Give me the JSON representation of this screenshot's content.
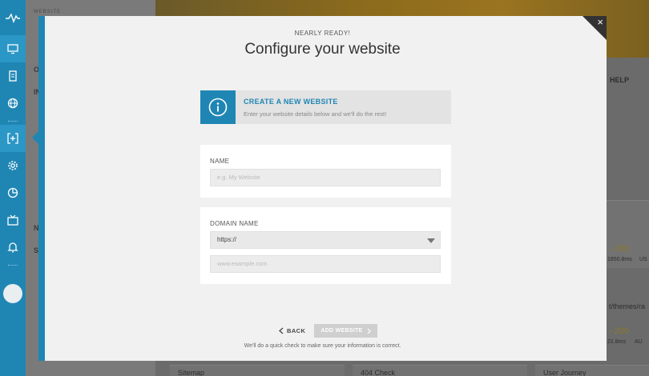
{
  "background": {
    "sidebar_labels": [
      "O",
      "IN",
      "N",
      "S"
    ],
    "sidebar_tiny": "WEBSITE",
    "help_label": "HELP",
    "cards": [
      {
        "status": "- 200",
        "timing": "1850.8ms",
        "region": "US"
      },
      {
        "status": "- 200",
        "timing": "21.8ms",
        "region": "AU"
      }
    ],
    "path_text": "t/themes/ra",
    "bottom_tabs": [
      "Sitemap",
      "404 Check",
      "User Journey"
    ]
  },
  "rail": {
    "icons": [
      "pulse-logo-icon",
      "monitor-icon",
      "server-icon",
      "globe-icon",
      "add-bracket-icon",
      "gear-icon",
      "pie-chart-icon",
      "tv-icon",
      "bell-icon"
    ]
  },
  "modal": {
    "eyebrow": "NEARLY READY!",
    "title": "Configure your website",
    "close_symbol": "×",
    "info": {
      "icon": "info-icon",
      "title": "CREATE A NEW WEBSITE",
      "description": "Enter your website details below and we'll do the rest!"
    },
    "name_section": {
      "label": "NAME",
      "placeholder": "e.g. My Website"
    },
    "domain_section": {
      "label": "DOMAIN NAME",
      "protocol_value": "https://",
      "domain_placeholder": "www.example.com"
    },
    "back_label": "BACK",
    "add_label": "ADD WEBSITE",
    "note": "We'll do a quick check to make sure your information is correct."
  },
  "colors": {
    "accent": "#1f86b4",
    "modal_bg": "#f1f1f1",
    "disabled_button": "#cfcfcf"
  }
}
